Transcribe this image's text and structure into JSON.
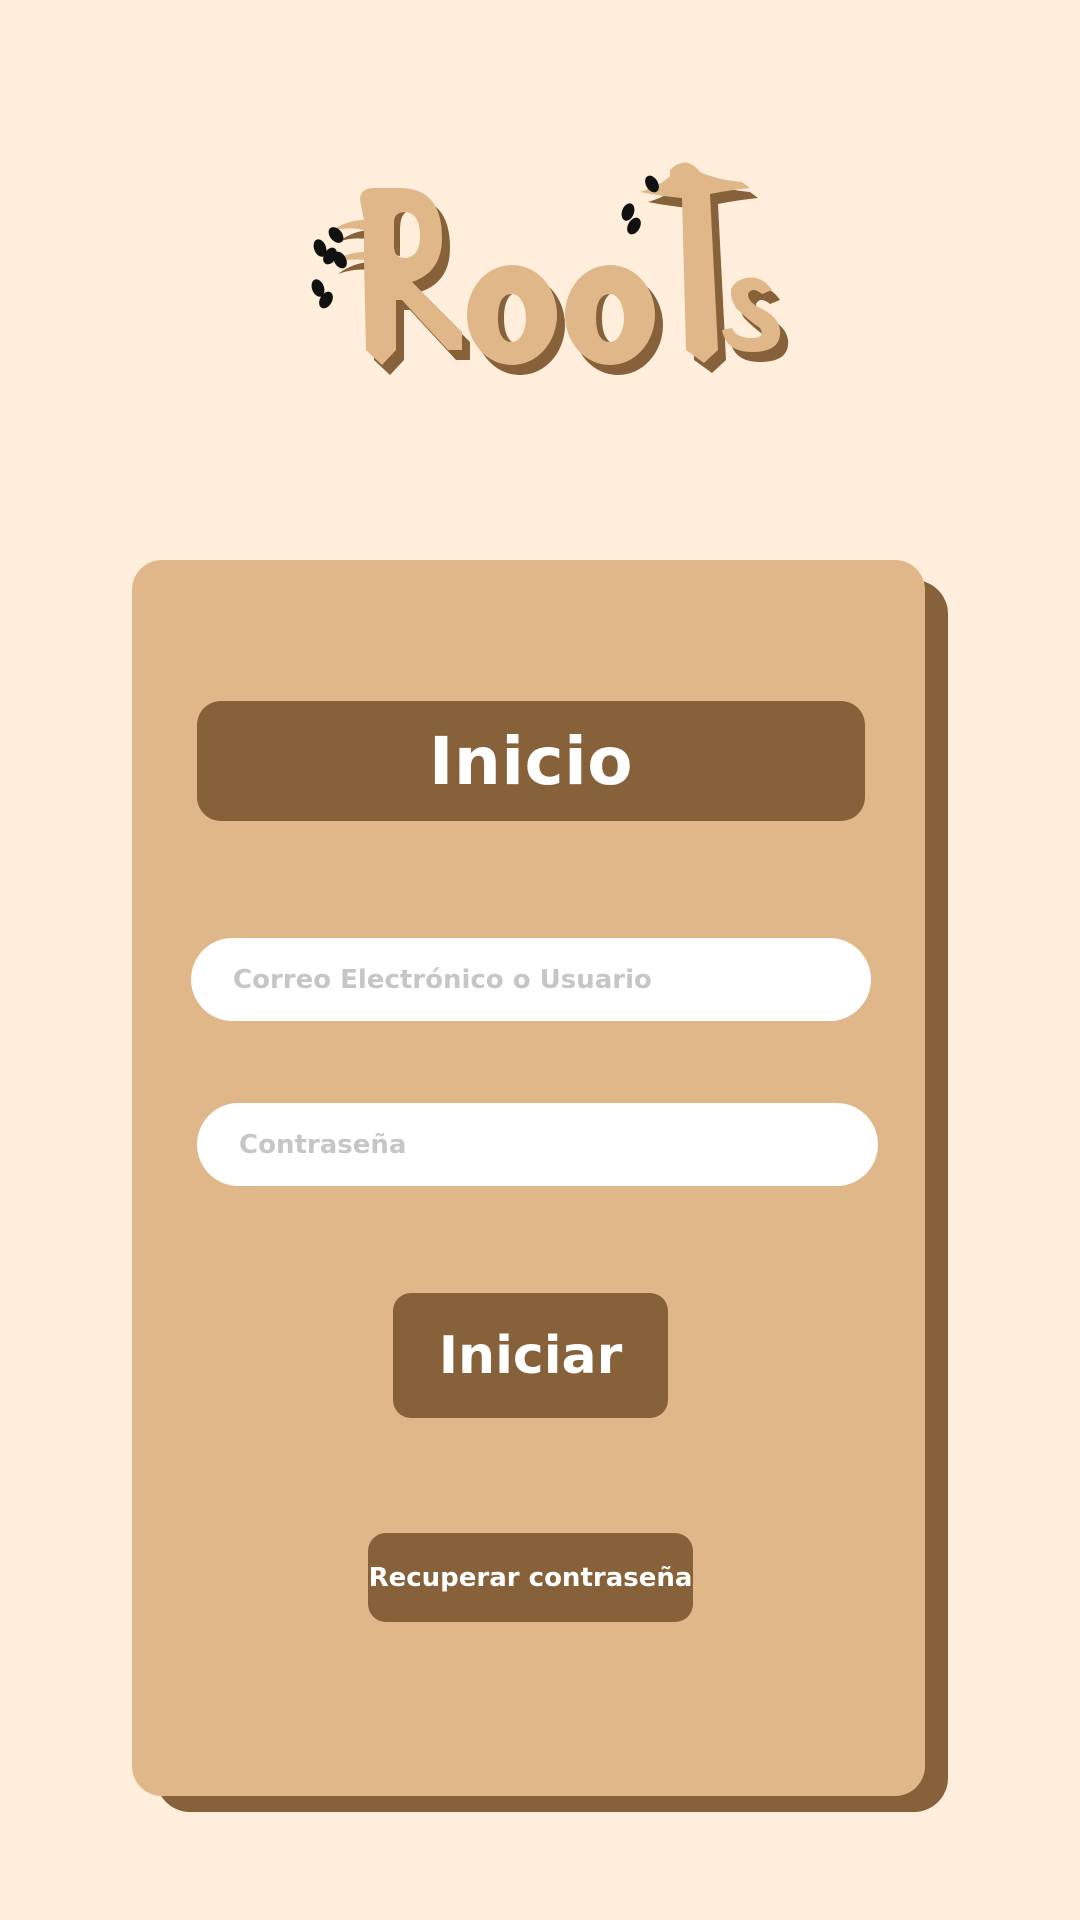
{
  "logo": {
    "text": "Roots",
    "colors": {
      "face": "#E0B789",
      "shadow": "#86613A",
      "leaf": "#111111"
    }
  },
  "card": {
    "title": "Inicio",
    "email_field": {
      "placeholder": "Correo Electrónico o Usuario",
      "value": ""
    },
    "password_field": {
      "placeholder": "Contraseña",
      "value": ""
    },
    "login_button": "Iniciar",
    "recover_button": "Recuperar contraseña"
  },
  "colors": {
    "background": "#FFEEDB",
    "card": "#E0B789",
    "accent": "#86613A",
    "placeholder": "#C6C6C6"
  }
}
